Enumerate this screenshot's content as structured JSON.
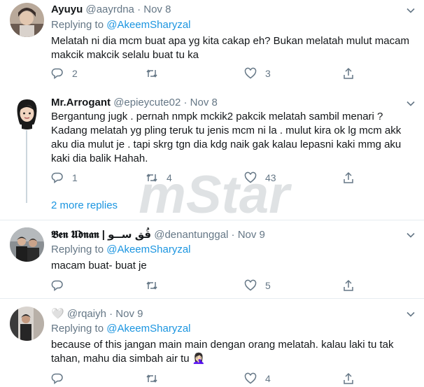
{
  "tweets": [
    {
      "name": "Ayuyu",
      "handle": "@aayrdna",
      "date": "Nov 8",
      "replying_prefix": "Replying to ",
      "replying_to": "@AkeemSharyzal",
      "text": "Melatah ni dia mcm buat apa yg kita cakap eh? Bukan melatah mulut macam\nmakcik makcik selalu buat tu ka",
      "replies": "2",
      "retweets": "",
      "likes": "3"
    },
    {
      "name": "Mr.Arrogant",
      "handle": "@epieycute02",
      "date": "Nov 8",
      "text": "Bergantung jugk . pernah nmpk mckik2 pakcik melatah sambil menari ?\nKadang melatah yg pling teruk tu jenis mcm ni la . mulut kira ok lg mcm akk\naku dia mulut je . tapi skrg tgn dia kdg naik gak kalau lepasni kaki mmg aku\nkaki dia balik Hahah.",
      "replies": "1",
      "retweets": "4",
      "likes": "43",
      "more_replies": "2 more replies"
    },
    {
      "name": "𝕭𝖊𝖓 𝖀𝖉𝖓𝖆𝖓 | قُق ســو",
      "handle": "@denantunggal",
      "date": "Nov 9",
      "replying_prefix": "Replying to ",
      "replying_to": "@AkeemSharyzal",
      "text": "macam buat- buat je",
      "replies": "",
      "retweets": "",
      "likes": "5"
    },
    {
      "name": "🤍",
      "handle": "@rqaiyh",
      "date": "Nov 9",
      "replying_prefix": "Replying to ",
      "replying_to": "@AkeemSharyzal",
      "text": "because of this jangan main main dengan orang melatah. kalau laki tu tak\ntahan, mahu dia simbah air tu 🤦🏻‍♀️",
      "replies": "",
      "retweets": "",
      "likes": "4"
    }
  ],
  "separator": "·",
  "watermark": "mStar",
  "colors": {
    "link": "#1b95e0",
    "muted": "#657786",
    "text": "#14171a",
    "divider": "#e6ecf0"
  },
  "icons": [
    "reply-icon",
    "retweet-icon",
    "like-icon",
    "share-icon",
    "caret-down-icon"
  ]
}
